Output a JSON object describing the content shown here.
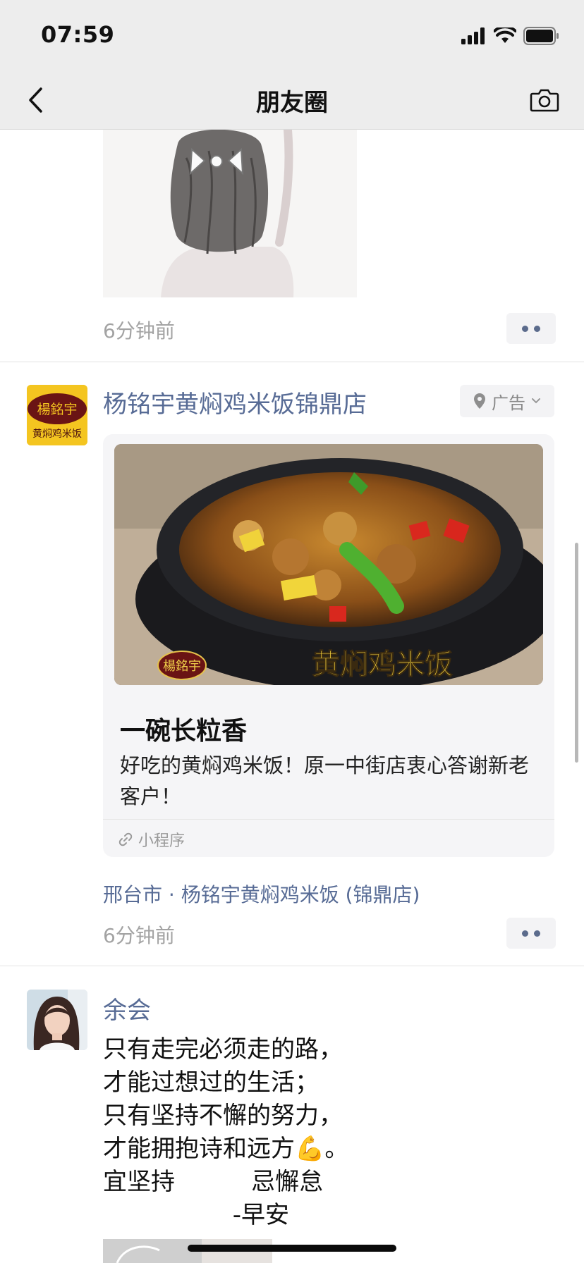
{
  "status_bar": {
    "time": "07:59"
  },
  "nav": {
    "title": "朋友圈"
  },
  "posts": [
    {
      "time_ago": "6分钟前"
    },
    {
      "author": "杨铭宇黄焖鸡米饭锦鼎店",
      "avatar_text_top": "楊銘宇",
      "avatar_text_bottom": "黄焖鸡米饭",
      "ad_label": "广告",
      "card": {
        "image_logo_text": "楊銘宇",
        "image_caption": "黄焖鸡米饭",
        "title": "一碗长粒香",
        "description": "好吃的黄焖鸡米饭！原一中街店衷心答谢新老客户！",
        "source": "小程序"
      },
      "location": "邢台市 · 杨铭宇黄焖鸡米饭 (锦鼎店)",
      "time_ago": "6分钟前"
    },
    {
      "author": "余会",
      "text": "只有走完必须走的路，\n才能过想过的生活；\n只有坚持不懈的努力，\n才能拥抱诗和远方💪。\n宜坚持          忌懈怠\n                 -早安"
    }
  ],
  "colors": {
    "link": "#576b95",
    "nav_bg": "#ededed",
    "meta_gray": "#a3a3a3",
    "card_bg": "#f5f5f7"
  },
  "icons": [
    "back-arrow-icon",
    "camera-icon",
    "signal-icon",
    "wifi-icon",
    "battery-icon",
    "location-pin-icon",
    "chevron-down-icon",
    "link-icon",
    "more-dots-icon",
    "flexed-biceps-emoji"
  ]
}
